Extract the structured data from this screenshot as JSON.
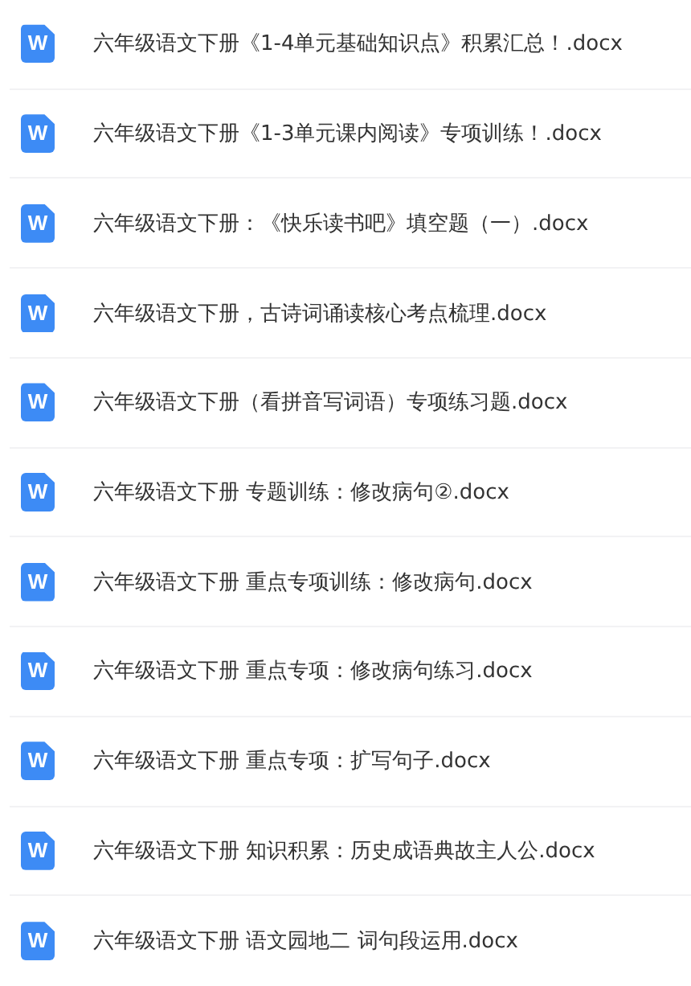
{
  "files": [
    {
      "icon": "W",
      "name": "六年级语文下册《1-4单元基础知识点》积累汇总！.docx"
    },
    {
      "icon": "W",
      "name": "六年级语文下册《1-3单元课内阅读》专项训练！.docx"
    },
    {
      "icon": "W",
      "name": "六年级语文下册：《快乐读书吧》填空题（一）.docx"
    },
    {
      "icon": "W",
      "name": "六年级语文下册，古诗词诵读核心考点梳理.docx"
    },
    {
      "icon": "W",
      "name": "六年级语文下册（看拼音写词语）专项练习题.docx"
    },
    {
      "icon": "W",
      "name": "六年级语文下册 专题训练：修改病句②.docx"
    },
    {
      "icon": "W",
      "name": "六年级语文下册 重点专项训练：修改病句.docx"
    },
    {
      "icon": "W",
      "name": "六年级语文下册 重点专项：修改病句练习.docx"
    },
    {
      "icon": "W",
      "name": "六年级语文下册 重点专项：扩写句子.docx"
    },
    {
      "icon": "W",
      "name": "六年级语文下册 知识积累：历史成语典故主人公.docx"
    },
    {
      "icon": "W",
      "name": "六年级语文下册 语文园地二 词句段运用.docx"
    }
  ]
}
